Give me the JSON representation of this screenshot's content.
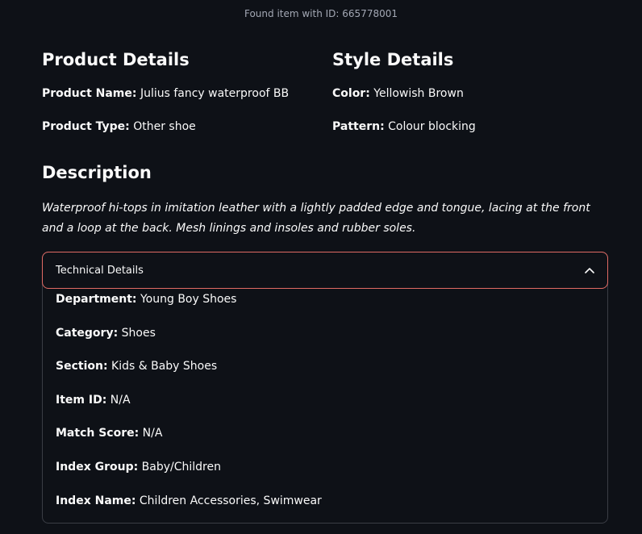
{
  "caption": "Found item with ID: 665778001",
  "product": {
    "heading": "Product Details",
    "name_label": "Product Name:",
    "name_value": "Julius fancy waterproof BB",
    "type_label": "Product Type:",
    "type_value": "Other shoe"
  },
  "style": {
    "heading": "Style Details",
    "color_label": "Color:",
    "color_value": "Yellowish Brown",
    "pattern_label": "Pattern:",
    "pattern_value": "Colour blocking"
  },
  "description": {
    "heading": "Description",
    "text": "Waterproof hi-tops in imitation leather with a lightly padded edge and tongue, lacing at the front and a loop at the back. Mesh linings and insoles and rubber soles."
  },
  "technical": {
    "title": "Technical Details",
    "icon": "chevron-up-icon",
    "expanded": true,
    "rows": [
      {
        "label": "Department:",
        "value": "Young Boy Shoes"
      },
      {
        "label": "Category:",
        "value": "Shoes"
      },
      {
        "label": "Section:",
        "value": "Kids & Baby Shoes"
      },
      {
        "label": "Item ID:",
        "value": "N/A"
      },
      {
        "label": "Match Score:",
        "value": "N/A"
      },
      {
        "label": "Index Group:",
        "value": "Baby/Children"
      },
      {
        "label": "Index Name:",
        "value": "Children Accessories, Swimwear"
      }
    ]
  },
  "colors": {
    "background": "#0e1117",
    "text": "#fafafa",
    "muted": "#a3a8b4",
    "focus_border": "#e06a64",
    "border": "#3a3d45"
  }
}
